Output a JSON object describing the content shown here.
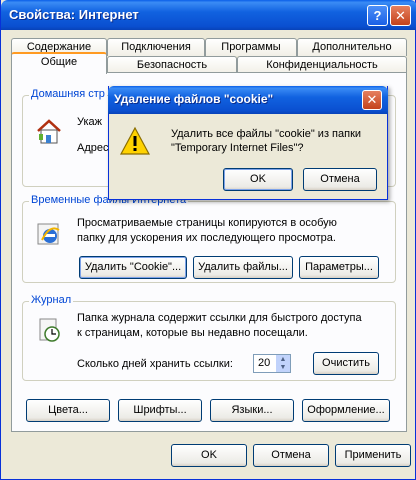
{
  "window": {
    "title": "Свойства: Интернет",
    "help_glyph": "?",
    "close_glyph": "✕"
  },
  "tabs": {
    "row1": [
      "Содержание",
      "Подключения",
      "Программы",
      "Дополнительно"
    ],
    "row2": [
      "Общие",
      "Безопасность",
      "Конфиденциальность"
    ],
    "active": "Общие"
  },
  "homepage": {
    "legend": "Домашняя стр",
    "text": "Укаж",
    "address_label": "Адрес"
  },
  "temp_files": {
    "legend": "Временные файлы Интернета",
    "description_line1": "Просматриваемые страницы копируются в особую",
    "description_line2": "папку для ускорения их последующего просмотра.",
    "delete_cookies": "Удалить \"Cookie\"...",
    "delete_files": "Удалить файлы...",
    "settings": "Параметры..."
  },
  "history": {
    "legend": "Журнал",
    "description_line1": "Папка журнала содержит ссылки для быстрого доступа",
    "description_line2": "к страницам, которые вы недавно посещали.",
    "days_label": "Сколько дней хранить ссылки:",
    "days_value": "20",
    "clear": "Очистить"
  },
  "bottom_buttons": {
    "colors": "Цвета...",
    "fonts": "Шрифты...",
    "languages": "Языки...",
    "accessibility": "Оформление..."
  },
  "dialog_buttons": {
    "ok": "OK",
    "cancel": "Отмена",
    "apply": "Применить"
  },
  "cookie_dialog": {
    "title": "Удаление файлов \"cookie\"",
    "message_line1": "Удалить все файлы \"cookie\" из папки",
    "message_line2": "\"Temporary Internet Files\"?",
    "ok": "OK",
    "cancel": "Отмена",
    "close_glyph": "✕"
  },
  "icons": {
    "homepage": "house-icon",
    "temp_files": "ie-logo-icon",
    "history": "history-clock-icon",
    "warning": "warning-icon"
  }
}
